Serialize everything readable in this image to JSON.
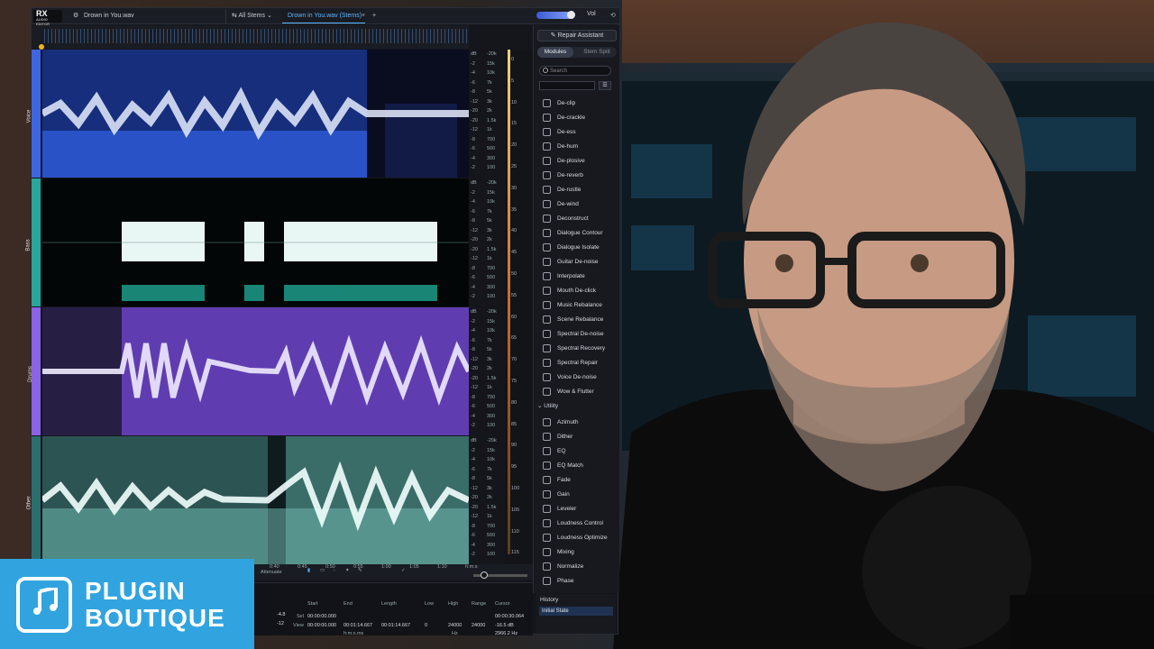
{
  "app": {
    "logo": "RX",
    "logo_sub": "AUDIO EDITOR",
    "tabs": [
      {
        "label": "Drown in You.wav"
      },
      {
        "label": "All Stems"
      },
      {
        "label": "Drown in You.wav (Stems)",
        "active": true
      }
    ],
    "new_tab": "+",
    "vol_label": "Vol",
    "colors": {
      "accent": "#5db8ff",
      "voice": "#3d66e0",
      "bass": "#2aa59a",
      "drums": "#8b63e6",
      "other": "#7fd6c8"
    }
  },
  "tracks": [
    {
      "name": "Voice"
    },
    {
      "name": "Bass"
    },
    {
      "name": "Drums"
    },
    {
      "name": "Other"
    }
  ],
  "scale": {
    "db": [
      "dB",
      "-2",
      "-4",
      "-6",
      "-8",
      "-12",
      "-20",
      "-20",
      "-12",
      "-8",
      "-6",
      "-4",
      "-2"
    ],
    "hz": [
      "-20k",
      "15k",
      "10k",
      "7k",
      "5k",
      "3k",
      "2k",
      "1.5k",
      "1k",
      "700",
      "500",
      "300",
      "100"
    ]
  },
  "meter_ticks": [
    "0",
    "5",
    "10",
    "15",
    "20",
    "25",
    "30",
    "35",
    "40",
    "45",
    "50",
    "55",
    "60",
    "65",
    "70",
    "75",
    "80",
    "85",
    "90",
    "95",
    "100",
    "105",
    "110",
    "115"
  ],
  "panel": {
    "repair_assistant": "Repair Assistant",
    "modules_tab": "Modules",
    "stem_split_tab": "Stem Split",
    "search_placeholder": "Search",
    "modules": [
      "De-clip",
      "De-crackle",
      "De-ess",
      "De-hum",
      "De-plosive",
      "De-reverb",
      "De-rustle",
      "De-wind",
      "Deconstruct",
      "Dialogue Contour",
      "Dialogue Isolate",
      "Guitar De-noise",
      "Interpolate",
      "Mouth De-click",
      "Music Rebalance",
      "Scene Rebalance",
      "Spectral De-noise",
      "Spectral Recovery",
      "Spectral Repair",
      "Voice De-noise",
      "Wow & Flutter"
    ],
    "utility_header": "Utility",
    "utility": [
      "Azimuth",
      "Dither",
      "EQ",
      "EQ Match",
      "Fade",
      "Gain",
      "Leveler",
      "Loudness Control",
      "Loudness Optimize",
      "Mixing",
      "Normalize",
      "Phase"
    ]
  },
  "timeline": {
    "labels": [
      "0:40",
      "0:45",
      "0:50",
      "0:55",
      "1:00",
      "1:05",
      "1:10",
      "h:m:s"
    ],
    "mode": "Attenuate"
  },
  "selection": {
    "headers": [
      "Start",
      "End",
      "Length",
      "Low",
      "High",
      "Range",
      "Cursor"
    ],
    "sel_label": "Sel",
    "view_label": "View",
    "sel": {
      "start": "00:00:00.000",
      "end": "",
      "length": "",
      "low": "",
      "high": "",
      "range": ""
    },
    "view": {
      "start": "00:00:00.000",
      "end": "00:01:14.667",
      "length": "00:01:14.667",
      "low": "0",
      "high": "24000",
      "range": "24000"
    },
    "cursor_time": "00:00:30.064",
    "cursor_db": "-16.5 dB",
    "cursor_hz": "2966.2 Hz",
    "unit_hms": "h:m:s.ms",
    "unit_hz": "Hz",
    "level_left": "-4.8",
    "level_right": "-12"
  },
  "history": {
    "title": "History",
    "items": [
      "Initial State"
    ]
  },
  "brand": {
    "line1": "PLUGIN",
    "line2": "BOUTIQUE",
    "color": "#31a4e0"
  }
}
